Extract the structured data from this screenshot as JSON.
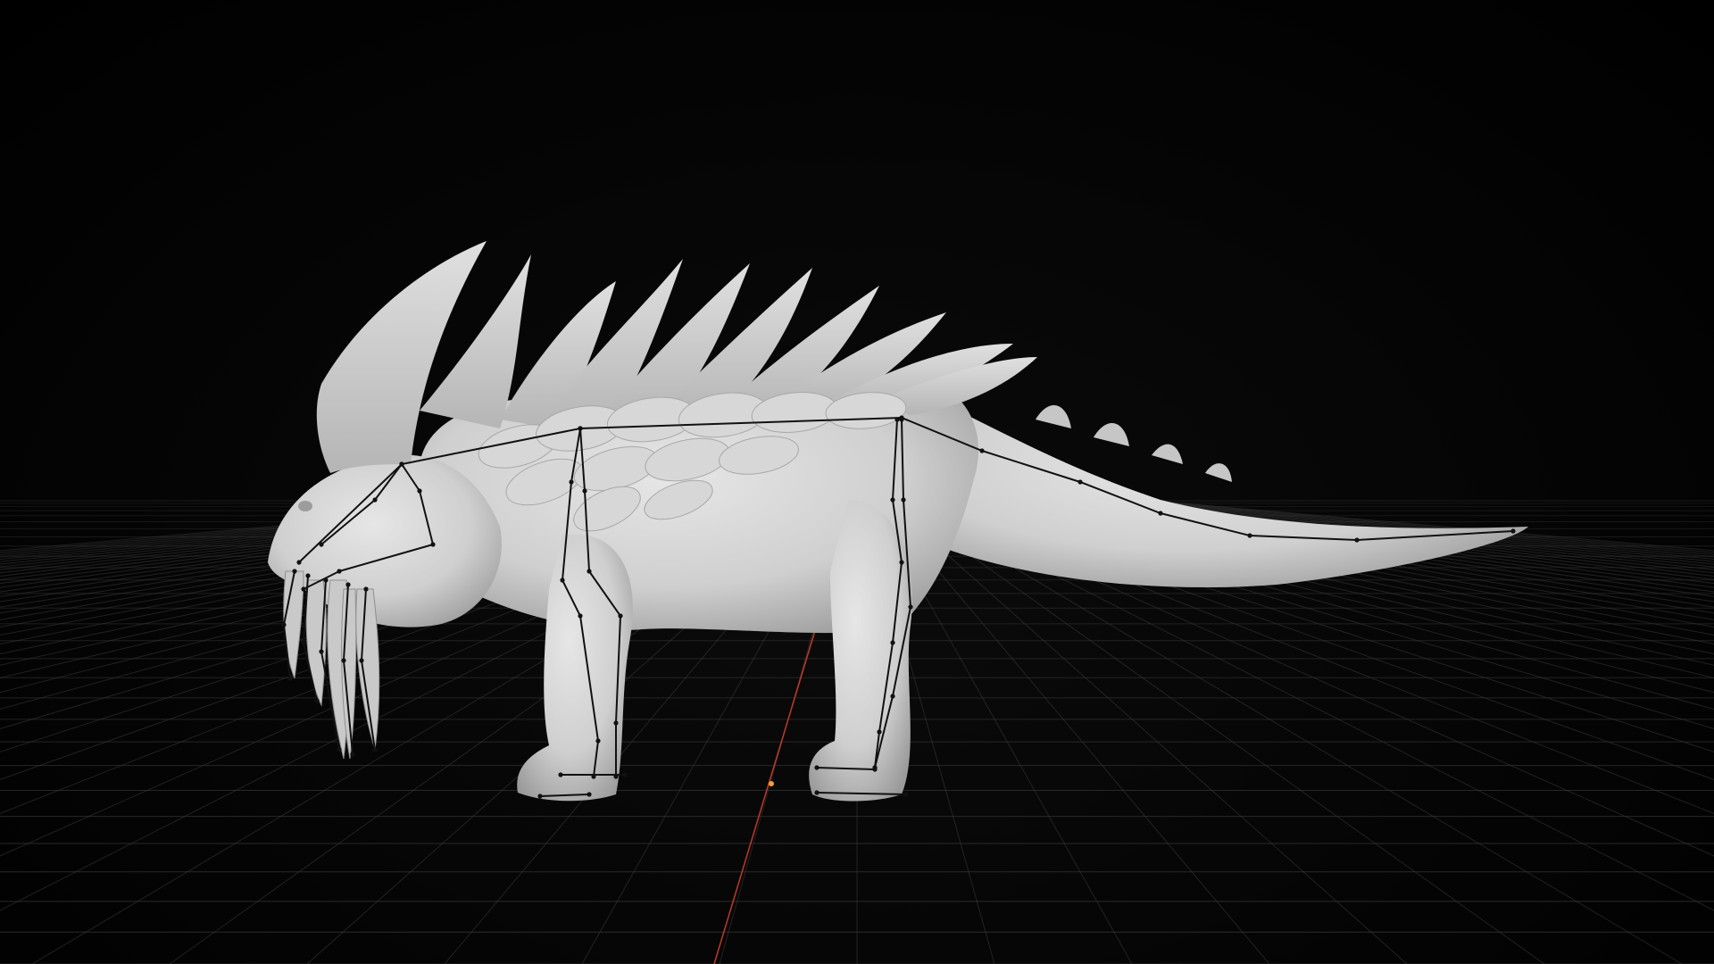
{
  "viewport": {
    "background_color": "#050505",
    "grid_color": "#3a3a3a",
    "mesh_color": "#cfcfcf",
    "bone_color": "#111111",
    "x_axis_color": "#c0392b",
    "origin_color": "#f0a030",
    "scene_object": "creature-sculpt",
    "armature": "creature-armature"
  }
}
